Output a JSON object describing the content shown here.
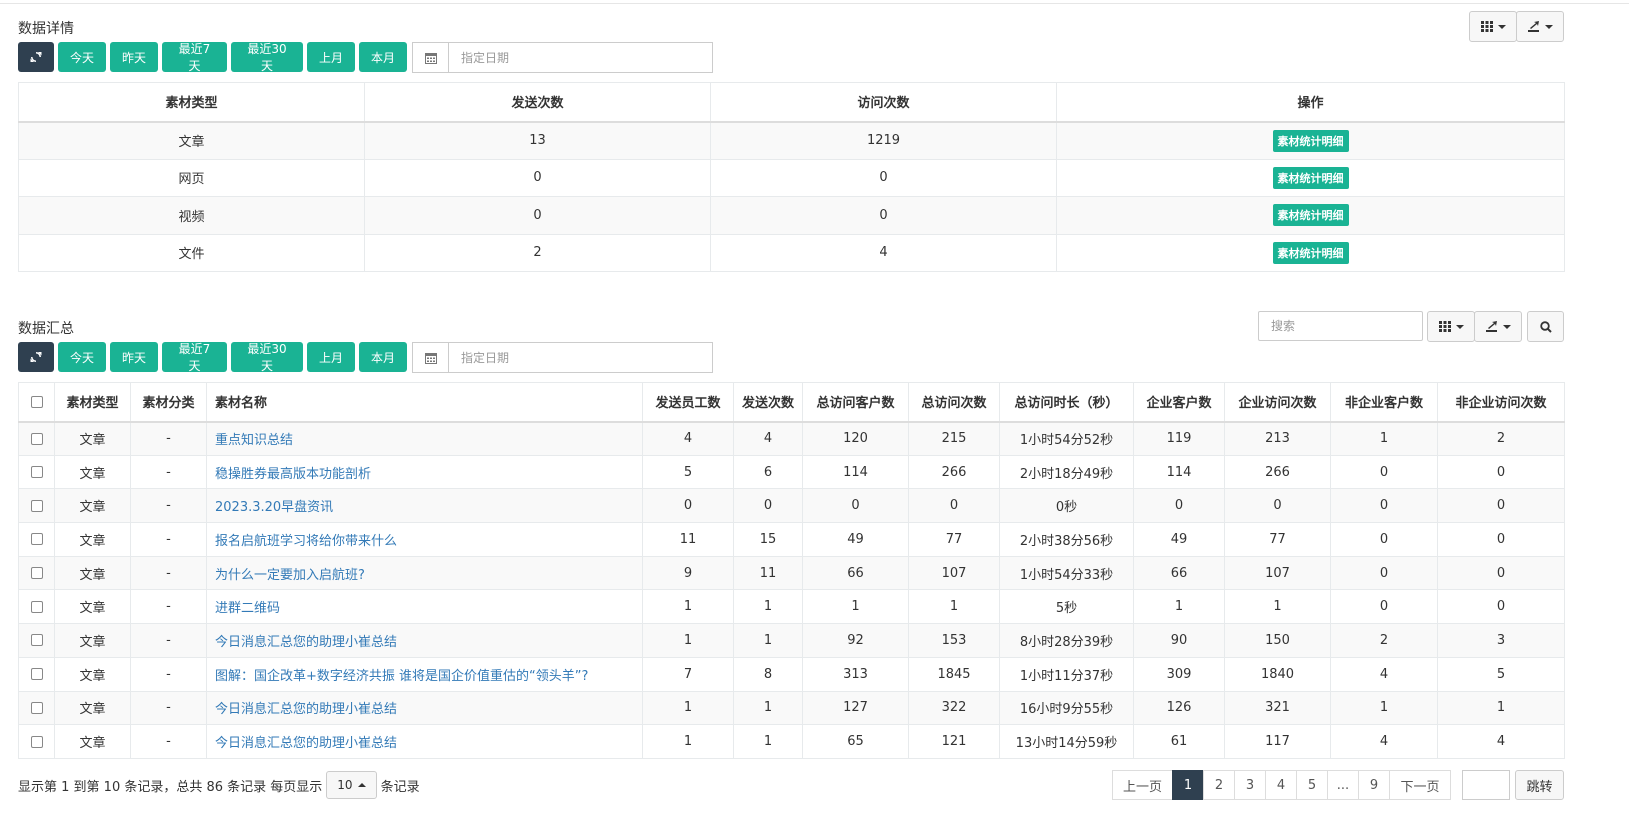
{
  "colors": {
    "dark": "#2f4050",
    "teal": "#1ab394",
    "link": "#337ab7"
  },
  "detail": {
    "title": "数据详情",
    "buttons": [
      "今天",
      "昨天",
      "最近7天",
      "最近30天",
      "上月",
      "本月"
    ],
    "date_placeholder": "指定日期",
    "headers": [
      "素材类型",
      "发送次数",
      "访问次数",
      "操作"
    ],
    "rows": [
      {
        "type": "文章",
        "sends": "13",
        "visits": "1219",
        "action": "素材统计明细"
      },
      {
        "type": "网页",
        "sends": "0",
        "visits": "0",
        "action": "素材统计明细"
      },
      {
        "type": "视频",
        "sends": "0",
        "visits": "0",
        "action": "素材统计明细"
      },
      {
        "type": "文件",
        "sends": "2",
        "visits": "4",
        "action": "素材统计明细"
      }
    ]
  },
  "summary": {
    "title": "数据汇总",
    "buttons": [
      "今天",
      "昨天",
      "最近7天",
      "最近30天",
      "上月",
      "本月"
    ],
    "date_placeholder": "指定日期",
    "search_placeholder": "搜索",
    "headers": [
      "素材类型",
      "素材分类",
      "素材名称",
      "发送员工数",
      "发送次数",
      "总访问客户数",
      "总访问次数",
      "总访问时长（秒）",
      "企业客户数",
      "企业访问次数",
      "非企业客户数",
      "非企业访问次数"
    ],
    "rows": [
      [
        "文章",
        "-",
        "重点知识总结",
        "4",
        "4",
        "120",
        "215",
        "1小时54分52秒",
        "119",
        "213",
        "1",
        "2"
      ],
      [
        "文章",
        "-",
        "稳操胜券最高版本功能剖析",
        "5",
        "6",
        "114",
        "266",
        "2小时18分49秒",
        "114",
        "266",
        "0",
        "0"
      ],
      [
        "文章",
        "-",
        "2023.3.20早盘资讯",
        "0",
        "0",
        "0",
        "0",
        "0秒",
        "0",
        "0",
        "0",
        "0"
      ],
      [
        "文章",
        "-",
        "报名启航班学习将给你带来什么",
        "11",
        "15",
        "49",
        "77",
        "2小时38分56秒",
        "49",
        "77",
        "0",
        "0"
      ],
      [
        "文章",
        "-",
        "为什么一定要加入启航班?",
        "9",
        "11",
        "66",
        "107",
        "1小时54分33秒",
        "66",
        "107",
        "0",
        "0"
      ],
      [
        "文章",
        "-",
        "进群二维码",
        "1",
        "1",
        "1",
        "1",
        "5秒",
        "1",
        "1",
        "0",
        "0"
      ],
      [
        "文章",
        "-",
        "今日消息汇总您的助理小崔总结",
        "1",
        "1",
        "92",
        "153",
        "8小时28分39秒",
        "90",
        "150",
        "2",
        "3"
      ],
      [
        "文章",
        "-",
        "图解：国企改革+数字经济共振 谁将是国企价值重估的“领头羊”?",
        "7",
        "8",
        "313",
        "1845",
        "1小时11分37秒",
        "309",
        "1840",
        "4",
        "5"
      ],
      [
        "文章",
        "-",
        "今日消息汇总您的助理小崔总结",
        "1",
        "1",
        "127",
        "322",
        "16小时9分55秒",
        "126",
        "321",
        "1",
        "1"
      ],
      [
        "文章",
        "-",
        "今日消息汇总您的助理小崔总结",
        "1",
        "1",
        "65",
        "121",
        "13小时14分59秒",
        "61",
        "117",
        "4",
        "4"
      ]
    ]
  },
  "footer": {
    "info_prefix": "显示第 1 到第 10 条记录，总共 86 条记录 每页显示",
    "page_size": "10",
    "info_suffix": "条记录",
    "pages": [
      "上一页",
      "1",
      "2",
      "3",
      "4",
      "5",
      "...",
      "9",
      "下一页"
    ],
    "active_page": "1",
    "goto_label": "跳转"
  }
}
